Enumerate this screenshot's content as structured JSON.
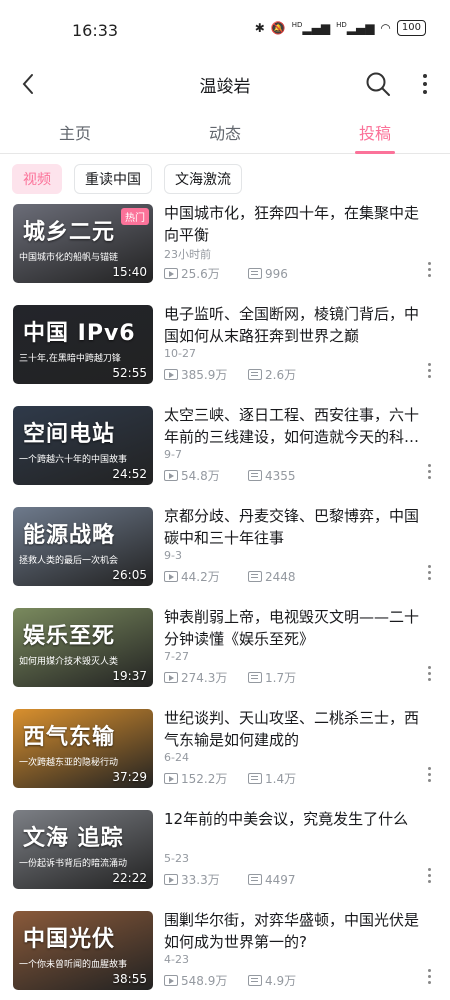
{
  "status": {
    "time": "16:33",
    "signal1": "HD",
    "signal2": "HD",
    "battery": "100"
  },
  "nav": {
    "title": "温竣岩"
  },
  "tabs": [
    "主页",
    "动态",
    "投稿"
  ],
  "chips": [
    "视频",
    "重读中国",
    "文海激流"
  ],
  "videos": [
    {
      "thumb_title": "城乡二元",
      "thumb_sub": "中国城市化的船帆与锚链",
      "duration": "15:40",
      "badge": "热门",
      "title": "中国城市化，狂奔四十年，在集聚中走向平衡",
      "date": "23小时前",
      "views": "25.6万",
      "danmaku": "996",
      "bg": "#6b6d78"
    },
    {
      "thumb_title": "中国 IPv6",
      "thumb_sub": "三十年,在黑暗中跨越刀锋",
      "duration": "52:55",
      "badge": "",
      "title": "电子监听、全国断网，棱镜门背后，中国如何从末路狂奔到世界之巅",
      "date": "10-27",
      "views": "385.9万",
      "danmaku": "2.6万",
      "bg": "#23252b"
    },
    {
      "thumb_title": "空间电站",
      "thumb_sub": "一个跨越六十年的中国故事",
      "duration": "24:52",
      "badge": "",
      "title": "太空三峡、逐日工程、西安往事，六十年前的三线建设，如何造就今天的科…",
      "date": "9-7",
      "views": "54.8万",
      "danmaku": "4355",
      "bg": "#2f3a4a"
    },
    {
      "thumb_title": "能源战略",
      "thumb_sub": "拯救人类的最后一次机会",
      "duration": "26:05",
      "badge": "",
      "title": "京都分歧、丹麦交锋、巴黎博弈，中国碳中和三十年往事",
      "date": "9-3",
      "views": "44.2万",
      "danmaku": "2448",
      "bg": "#6e7a8c"
    },
    {
      "thumb_title": "娱乐至死",
      "thumb_sub": "如何用媒介技术毁灭人类",
      "duration": "19:37",
      "badge": "",
      "title": "钟表削弱上帝，电视毁灭文明——二十分钟读懂《娱乐至死》",
      "date": "7-27",
      "views": "274.3万",
      "danmaku": "1.7万",
      "bg": "#7a8a5e"
    },
    {
      "thumb_title": "西气东输",
      "thumb_sub": "一次跨越东亚的隐秘行动",
      "duration": "37:29",
      "badge": "",
      "title": "世纪谈判、天山攻坚、二桃杀三士，西气东输是如何建成的",
      "date": "6-24",
      "views": "152.2万",
      "danmaku": "1.4万",
      "bg": "#d9902e"
    },
    {
      "thumb_title": "文海 追踪",
      "thumb_sub": "一份起诉书背后的暗流涌动",
      "duration": "22:22",
      "badge": "",
      "title": "12年前的中美会议，究竟发生了什么",
      "date": "5-23",
      "views": "33.3万",
      "danmaku": "4497",
      "bg": "#7c7f85"
    },
    {
      "thumb_title": "中国光伏",
      "thumb_sub": "一个你未曾听闻的血腥故事",
      "duration": "38:55",
      "badge": "",
      "title": "围剿华尔街，对弈华盛顿，中国光伏是如何成为世界第一的?",
      "date": "4-23",
      "views": "548.9万",
      "danmaku": "4.9万",
      "bg": "#8a5a3a"
    }
  ]
}
